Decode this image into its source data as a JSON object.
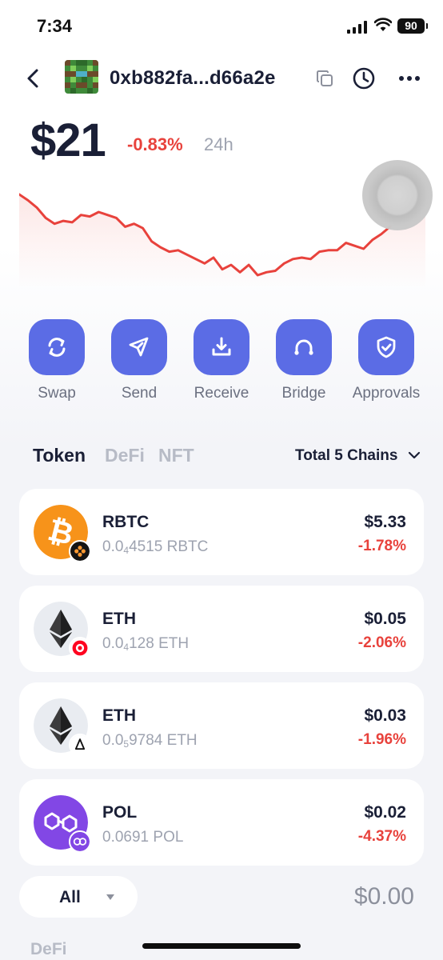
{
  "status_bar": {
    "time": "7:34",
    "battery": "90"
  },
  "header": {
    "address": "0xb882fa...d66a2e",
    "icons": [
      "back-icon",
      "avatar",
      "copy-icon",
      "history-icon",
      "more-icon"
    ]
  },
  "balance": {
    "value": "$21",
    "change": "-0.83%",
    "period": "24h"
  },
  "price_chart": {
    "type": "line",
    "color": "#e8423c",
    "points": [
      62,
      58,
      53,
      46,
      42,
      44,
      43,
      48,
      47,
      50,
      48,
      46,
      40,
      42,
      39,
      30,
      26,
      23,
      24,
      21,
      18,
      15,
      19,
      11,
      14,
      9,
      14,
      7,
      9,
      10,
      15,
      18,
      19,
      18,
      23,
      24,
      24,
      29,
      27,
      25,
      31,
      35,
      40,
      52,
      58,
      62,
      68
    ]
  },
  "actions": [
    {
      "label": "Swap",
      "icon": "swap-icon"
    },
    {
      "label": "Send",
      "icon": "send-icon"
    },
    {
      "label": "Receive",
      "icon": "receive-icon"
    },
    {
      "label": "Bridge",
      "icon": "bridge-icon"
    },
    {
      "label": "Approvals",
      "icon": "approvals-icon"
    }
  ],
  "tabs": {
    "token": "Token",
    "defi": "DeFi",
    "nft": "NFT",
    "chains": "Total 5 Chains"
  },
  "tokens": [
    {
      "symbol": "RBTC",
      "amount_prefix": "0.0",
      "amount_sub": "4",
      "amount_suffix": "4515 RBTC",
      "value": "$5.33",
      "change": "-1.78%",
      "icon": "bitcoin-icon",
      "chain": "rootstock-chain-icon"
    },
    {
      "symbol": "ETH",
      "amount_prefix": "0.0",
      "amount_sub": "4",
      "amount_suffix": "128 ETH",
      "value": "$0.05",
      "change": "-2.06%",
      "icon": "ethereum-icon",
      "chain": "optimism-chain-icon"
    },
    {
      "symbol": "ETH",
      "amount_prefix": "0.0",
      "amount_sub": "5",
      "amount_suffix": "9784 ETH",
      "value": "$0.03",
      "change": "-1.96%",
      "icon": "ethereum-icon",
      "chain": "linea-chain-icon"
    },
    {
      "symbol": "POL",
      "amount_prefix": "0.0691 POL",
      "amount_sub": "",
      "amount_suffix": "",
      "value": "$0.02",
      "change": "-4.37%",
      "icon": "polygon-icon",
      "chain": "polygon-chain-icon"
    }
  ],
  "bottom": {
    "filter": "All",
    "total": "$0.00",
    "section": "DeFi"
  },
  "colors": {
    "accent": "#5b6ce5",
    "negative": "#e8423c",
    "text": "#1a1f36",
    "muted": "#9ea3b0"
  }
}
